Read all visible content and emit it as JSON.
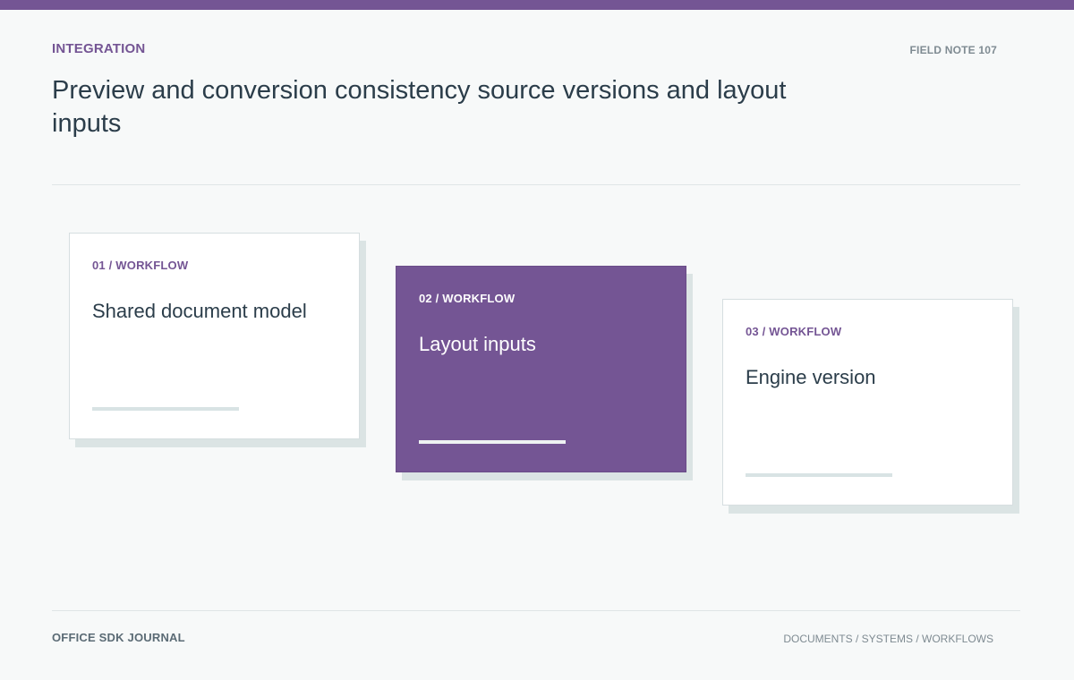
{
  "header": {
    "eyebrow": "INTEGRATION",
    "field_note": "FIELD NOTE 107",
    "title": "Preview and conversion consistency source versions and layout inputs"
  },
  "cards": [
    {
      "kicker": "01 / WORKFLOW",
      "title": "Shared document model",
      "featured": false
    },
    {
      "kicker": "02 / WORKFLOW",
      "title": "Layout inputs",
      "featured": true
    },
    {
      "kicker": "03 / WORKFLOW",
      "title": "Engine version",
      "featured": false
    }
  ],
  "footer": {
    "publication": "OFFICE SDK JOURNAL",
    "sections": "DOCUMENTS / SYSTEMS / WORKFLOWS"
  },
  "colors": {
    "accent": "#745594",
    "background": "#f7f9f9",
    "text": "#2b3d4a"
  }
}
